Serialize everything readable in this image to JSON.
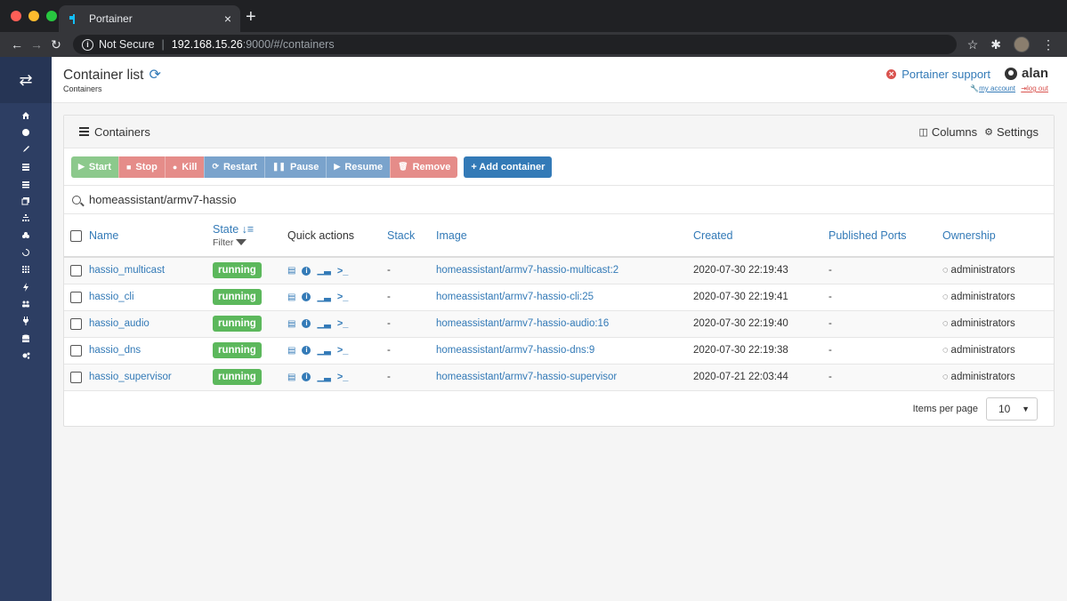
{
  "browser": {
    "tab_title": "Portainer",
    "tab_close": "×",
    "new_tab": "+",
    "url_secure_label": "Not Secure",
    "url_host": "192.168.15.26",
    "url_path": ":9000/#/containers"
  },
  "header": {
    "title": "Container list",
    "breadcrumb": "Containers",
    "support_label": "Portainer support",
    "username": "alan",
    "my_account": "my account",
    "log_out": "log out"
  },
  "widget": {
    "title": "Containers",
    "columns_label": "Columns",
    "settings_label": "Settings"
  },
  "actions": {
    "start": "Start",
    "stop": "Stop",
    "kill": "Kill",
    "restart": "Restart",
    "pause": "Pause",
    "resume": "Resume",
    "remove": "Remove",
    "add": "+ Add container"
  },
  "search": {
    "value": "homeassistant/armv7-hassio"
  },
  "table": {
    "columns": {
      "name": "Name",
      "state": "State",
      "filter": "Filter",
      "quick_actions": "Quick actions",
      "stack": "Stack",
      "image": "Image",
      "created": "Created",
      "ports": "Published Ports",
      "ownership": "Ownership"
    },
    "rows": [
      {
        "name": "hassio_multicast",
        "state": "running",
        "stack": "-",
        "image": "homeassistant/armv7-hassio-multicast:2",
        "created": "2020-07-30 22:19:43",
        "ports": "-",
        "ownership": "administrators"
      },
      {
        "name": "hassio_cli",
        "state": "running",
        "stack": "-",
        "image": "homeassistant/armv7-hassio-cli:25",
        "created": "2020-07-30 22:19:41",
        "ports": "-",
        "ownership": "administrators"
      },
      {
        "name": "hassio_audio",
        "state": "running",
        "stack": "-",
        "image": "homeassistant/armv7-hassio-audio:16",
        "created": "2020-07-30 22:19:40",
        "ports": "-",
        "ownership": "administrators"
      },
      {
        "name": "hassio_dns",
        "state": "running",
        "stack": "-",
        "image": "homeassistant/armv7-hassio-dns:9",
        "created": "2020-07-30 22:19:38",
        "ports": "-",
        "ownership": "administrators"
      },
      {
        "name": "hassio_supervisor",
        "state": "running",
        "stack": "-",
        "image": "homeassistant/armv7-hassio-supervisor",
        "created": "2020-07-21 22:03:44",
        "ports": "-",
        "ownership": "administrators"
      }
    ]
  },
  "pagination": {
    "items_per_page_label": "Items per page",
    "items_per_page_value": "10"
  },
  "colors": {
    "sidebar": "#2d3e63",
    "link": "#337ab7",
    "running": "#5cb85c"
  }
}
